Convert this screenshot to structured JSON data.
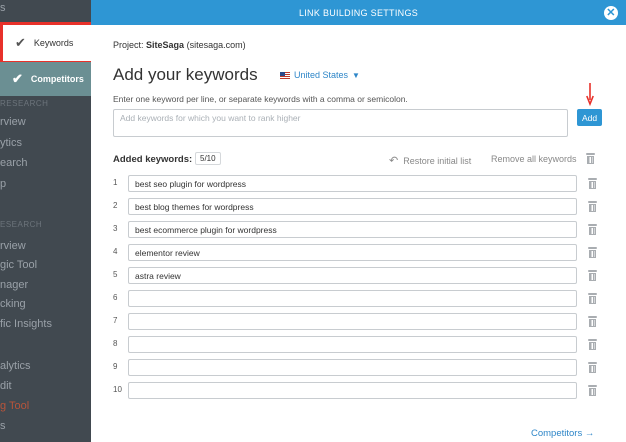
{
  "background_sidebar": {
    "items": [
      {
        "label": "s",
        "kind": "item",
        "tone": "normal"
      },
      {
        "label": "RESEARCH",
        "kind": "section",
        "tone": "normal"
      },
      {
        "label": "rview",
        "kind": "item",
        "tone": "normal"
      },
      {
        "label": "ytics",
        "kind": "item",
        "tone": "normal"
      },
      {
        "label": "earch",
        "kind": "item",
        "tone": "normal"
      },
      {
        "label": "p",
        "kind": "item",
        "tone": "normal"
      },
      {
        "label": "ESEARCH",
        "kind": "section",
        "tone": "normal"
      },
      {
        "label": "rview",
        "kind": "item",
        "tone": "normal"
      },
      {
        "label": "gic Tool",
        "kind": "item",
        "tone": "normal"
      },
      {
        "label": "nager",
        "kind": "item",
        "tone": "normal"
      },
      {
        "label": "cking",
        "kind": "item",
        "tone": "normal"
      },
      {
        "label": "fic Insights",
        "kind": "item",
        "tone": "normal"
      },
      {
        "label": "alytics",
        "kind": "item",
        "tone": "normal"
      },
      {
        "label": "dit",
        "kind": "item",
        "tone": "normal"
      },
      {
        "label": "g Tool",
        "kind": "item",
        "tone": "accent"
      },
      {
        "label": "s",
        "kind": "item",
        "tone": "normal"
      }
    ]
  },
  "steps": {
    "keywords": {
      "label": "Keywords",
      "icon": "check-icon"
    },
    "competitors": {
      "label": "Competitors",
      "icon": "check-icon"
    }
  },
  "panel": {
    "header_title": "LINK BUILDING SETTINGS",
    "close_icon": "close-icon",
    "project_prefix": "Project:",
    "project_name": "SiteSaga",
    "project_domain": "(sitesaga.com)",
    "title": "Add your keywords",
    "country": "United States",
    "instructions": "Enter one keyword per line, or separate keywords with a comma or semicolon.",
    "input_placeholder": "Add keywords for which you want to rank higher",
    "input_value": "",
    "add_label": "Add",
    "added_label": "Added keywords:",
    "count": "5/10",
    "restore_label": "Restore initial list",
    "remove_all_label": "Remove all keywords",
    "competitors_link": "Competitors →"
  },
  "keywords": [
    {
      "num": "1",
      "value": "best seo plugin for wordpress"
    },
    {
      "num": "2",
      "value": "best blog themes for wordpress"
    },
    {
      "num": "3",
      "value": "best ecommerce plugin for wordpress"
    },
    {
      "num": "4",
      "value": "elementor review"
    },
    {
      "num": "5",
      "value": "astra review"
    },
    {
      "num": "6",
      "value": ""
    },
    {
      "num": "7",
      "value": ""
    },
    {
      "num": "8",
      "value": ""
    },
    {
      "num": "9",
      "value": ""
    },
    {
      "num": "10",
      "value": ""
    }
  ],
  "colors": {
    "accent_blue": "#2e96d4",
    "highlight_red": "#e8312a",
    "competitors_step": "#6b8f93"
  }
}
